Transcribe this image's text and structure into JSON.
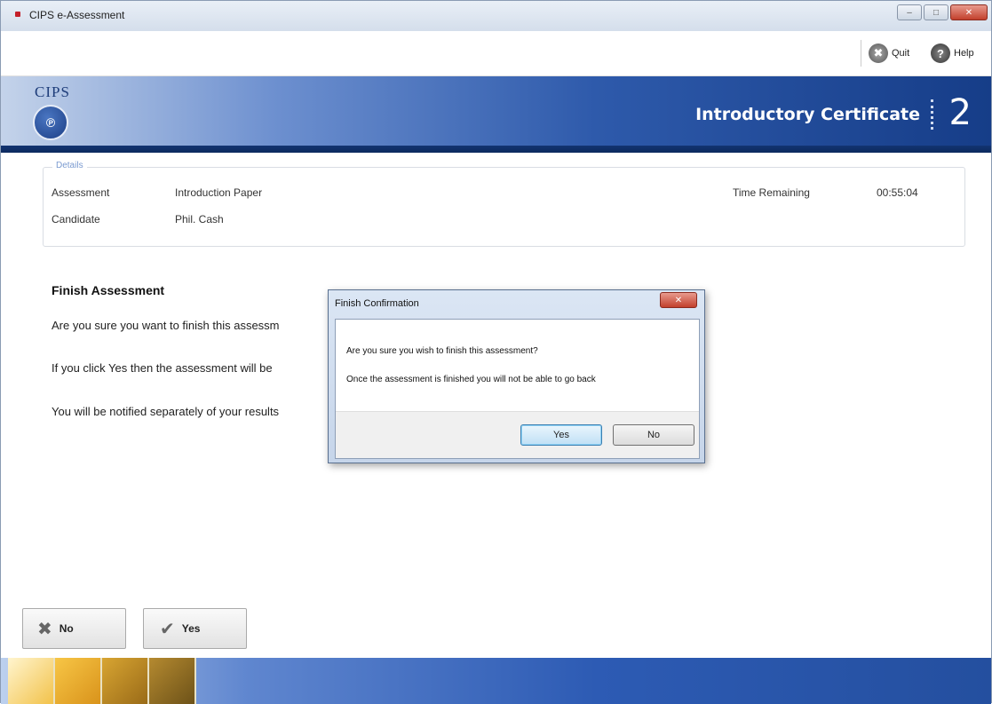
{
  "window": {
    "title": "CIPS e-Assessment"
  },
  "toolbar": {
    "quit_label": "Quit",
    "help_label": "Help"
  },
  "banner": {
    "brand": "CIPS",
    "certificate": "Introductory Certificate",
    "level": "2"
  },
  "details": {
    "legend": "Details",
    "assessment_label": "Assessment",
    "assessment_value": "Introduction Paper",
    "candidate_label": "Candidate",
    "candidate_value": "Phil. Cash",
    "time_label": "Time Remaining",
    "time_value": "00:55:04"
  },
  "content": {
    "heading": "Finish Assessment",
    "line1": "Are you sure you want to finish this assessm",
    "line2": "If you click Yes then the assessment will be",
    "line3": "You will be notified separately of your results"
  },
  "dialog": {
    "title": "Finish Confirmation",
    "message1": "Are you sure you wish to finish this assessment?",
    "message2": "Once the assessment is finished you will not be able to go back",
    "yes_label": "Yes",
    "no_label": "No"
  },
  "actions": {
    "no_label": "No",
    "yes_label": "Yes"
  }
}
